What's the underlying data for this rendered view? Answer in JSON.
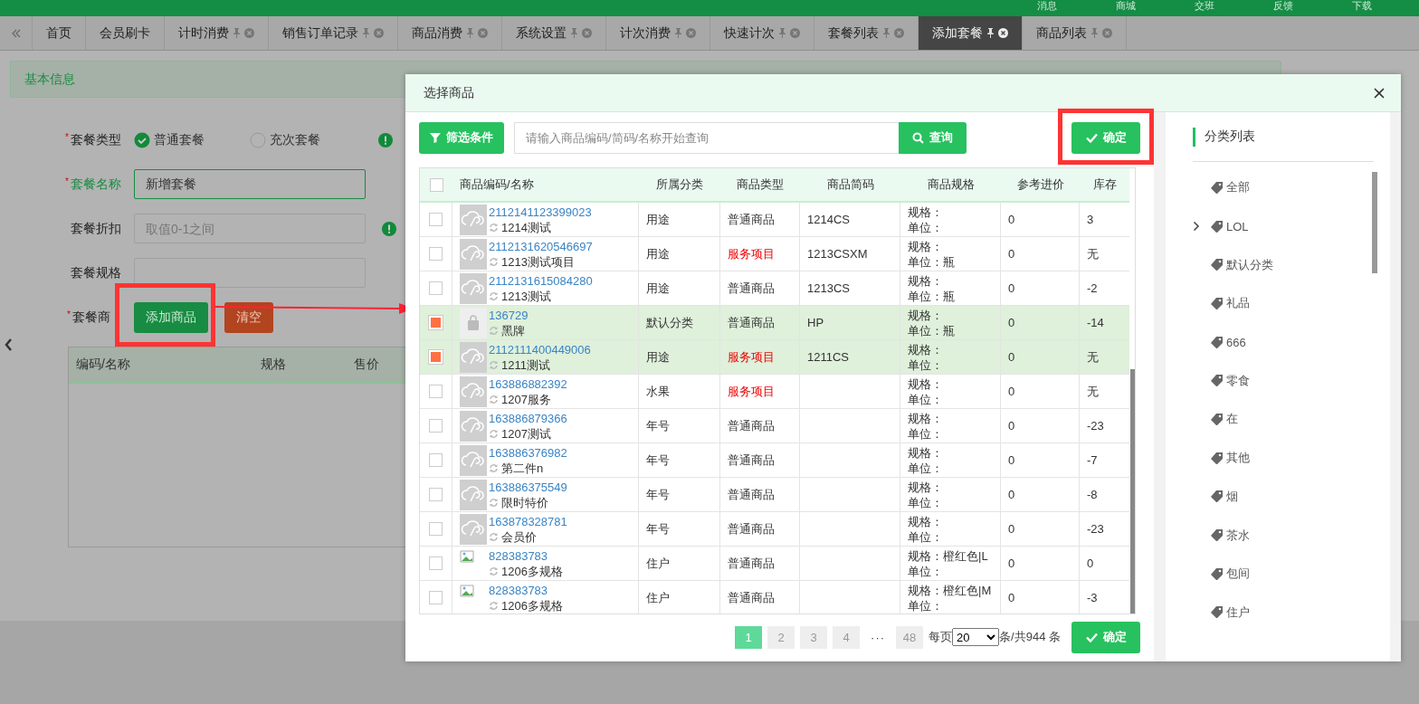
{
  "top_bar": {
    "links": [
      "消息",
      "商城",
      "交班",
      "反馈",
      "下载"
    ]
  },
  "tabs": [
    {
      "label": "首页",
      "selected": false,
      "pinnable": false
    },
    {
      "label": "会员刷卡",
      "selected": false,
      "pinnable": false
    },
    {
      "label": "计时消费",
      "selected": false,
      "pinnable": true
    },
    {
      "label": "销售订单记录",
      "selected": false,
      "pinnable": true
    },
    {
      "label": "商品消费",
      "selected": false,
      "pinnable": true
    },
    {
      "label": "系统设置",
      "selected": false,
      "pinnable": true
    },
    {
      "label": "计次消费",
      "selected": false,
      "pinnable": true
    },
    {
      "label": "快速计次",
      "selected": false,
      "pinnable": true
    },
    {
      "label": "套餐列表",
      "selected": false,
      "pinnable": true
    },
    {
      "label": "添加套餐",
      "selected": true,
      "pinnable": true
    },
    {
      "label": "商品列表",
      "selected": false,
      "pinnable": true
    }
  ],
  "section_title": "基本信息",
  "form": {
    "required_mark": "*",
    "type_row": {
      "label": "套餐类型",
      "required": true,
      "options": [
        {
          "label": "普通套餐",
          "selected": true
        },
        {
          "label": "充次套餐",
          "selected": false
        }
      ]
    },
    "name_row": {
      "label": "套餐名称",
      "required": true,
      "value": "新增套餐",
      "focused": true
    },
    "discount_row": {
      "label": "套餐折扣",
      "required": false,
      "placeholder": "取值0-1之间"
    },
    "spec_row": {
      "label": "套餐规格",
      "required": false
    },
    "goods_row": {
      "label": "套餐商",
      "required": true,
      "add_button": "添加商品",
      "clear_button": "清空"
    },
    "goods_table": {
      "columns": [
        "编码/名称",
        "规格",
        "售价"
      ]
    }
  },
  "dialog": {
    "title": "选择商品",
    "filter_button": "筛选条件",
    "search": {
      "placeholder": "请输入商品编码/简码/名称开始查询"
    },
    "query_button": "查询",
    "confirm_button": "确定",
    "table": {
      "select_all": false,
      "columns": [
        "商品编码/名称",
        "所属分类",
        "商品类型",
        "商品简码",
        "商品规格",
        "参考进价",
        "库存"
      ],
      "rows": [
        {
          "selected": false,
          "kind": "cloud",
          "code": "2112141123399023",
          "name": "1214测试",
          "category": "用途",
          "type": "普通商品",
          "highlighted": false,
          "short_code": "1214CS",
          "spec": "规格：",
          "unit": "单位：",
          "price": "0",
          "stock": "3"
        },
        {
          "selected": false,
          "kind": "cloud",
          "code": "2112131620546697",
          "name": "1213测试项目",
          "category": "用途",
          "type": "服务项目",
          "highlighted": true,
          "short_code": "1213CSXM",
          "spec": "规格：",
          "unit": "单位：瓶",
          "price": "0",
          "stock": "无"
        },
        {
          "selected": false,
          "kind": "cloud",
          "code": "2112131615084280",
          "name": "1213测试",
          "category": "用途",
          "type": "普通商品",
          "highlighted": false,
          "short_code": "1213CS",
          "spec": "规格：",
          "unit": "单位：瓶",
          "price": "0",
          "stock": "-2"
        },
        {
          "selected": true,
          "kind": "bag",
          "code": "136729",
          "name": "黑牌",
          "category": "默认分类",
          "type": "普通商品",
          "highlighted": false,
          "short_code": "HP",
          "spec": "规格：",
          "unit": "单位：瓶",
          "price": "0",
          "stock": "-14"
        },
        {
          "selected": true,
          "kind": "cloud",
          "code": "2112111400449006",
          "name": "1211测试",
          "category": "用途",
          "type": "服务项目",
          "highlighted": true,
          "short_code": "1211CS",
          "spec": "规格：",
          "unit": "单位：",
          "price": "0",
          "stock": "无"
        },
        {
          "selected": false,
          "kind": "cloud",
          "code": "163886882392",
          "name": "1207服务",
          "category": "水果",
          "type": "服务项目",
          "highlighted": true,
          "short_code": "",
          "spec": "规格：",
          "unit": "单位：",
          "price": "0",
          "stock": "无"
        },
        {
          "selected": false,
          "kind": "cloud",
          "code": "163886879366",
          "name": "1207测试",
          "category": "年号",
          "type": "普通商品",
          "highlighted": false,
          "short_code": "",
          "spec": "规格：",
          "unit": "单位：",
          "price": "0",
          "stock": "-23"
        },
        {
          "selected": false,
          "kind": "cloud",
          "code": "163886376982",
          "name": "第二件n",
          "category": "年号",
          "type": "普通商品",
          "highlighted": false,
          "short_code": "",
          "spec": "规格：",
          "unit": "单位：",
          "price": "0",
          "stock": "-7"
        },
        {
          "selected": false,
          "kind": "cloud",
          "code": "163886375549",
          "name": "限时特价",
          "category": "年号",
          "type": "普通商品",
          "highlighted": false,
          "short_code": "",
          "spec": "规格：",
          "unit": "单位：",
          "price": "0",
          "stock": "-8"
        },
        {
          "selected": false,
          "kind": "cloud",
          "code": "163878328781",
          "name": "会员价",
          "category": "年号",
          "type": "普通商品",
          "highlighted": false,
          "short_code": "",
          "spec": "规格：",
          "unit": "单位：",
          "price": "0",
          "stock": "-23"
        },
        {
          "selected": false,
          "kind": "broken",
          "code": "828383783",
          "name": "1206多规格",
          "category": "住户",
          "type": "普通商品",
          "highlighted": false,
          "short_code": "",
          "spec": "规格：橙红色|L",
          "unit": "单位：",
          "price": "0",
          "stock": "0"
        },
        {
          "selected": false,
          "kind": "broken",
          "code": "828383783",
          "name": "1206多规格",
          "category": "住户",
          "type": "普通商品",
          "highlighted": false,
          "short_code": "",
          "spec": "规格：橙红色|M",
          "unit": "单位：",
          "price": "0",
          "stock": "-3"
        }
      ]
    }
  },
  "pagination": {
    "pages": [
      {
        "label": "1",
        "selected": true
      },
      {
        "label": "2",
        "selected": false
      },
      {
        "label": "3",
        "selected": false
      },
      {
        "label": "4",
        "selected": false
      }
    ],
    "ellipsis": "···",
    "last": {
      "label": "48",
      "selected": false
    },
    "per_page_label": "每页",
    "per_page": "20",
    "total": "条/共944 条"
  },
  "footer_confirm": "确定",
  "categories": {
    "title": "分类列表",
    "items": [
      {
        "label": "全部",
        "kind": "leaf"
      },
      {
        "label": "LOL",
        "kind": "group",
        "expanded": false
      },
      {
        "label": "默认分类",
        "kind": "leaf"
      },
      {
        "label": "礼品",
        "kind": "leaf"
      },
      {
        "label": "666",
        "kind": "leaf"
      },
      {
        "label": "零食",
        "kind": "leaf"
      },
      {
        "label": "在",
        "kind": "leaf"
      },
      {
        "label": "其他",
        "kind": "leaf"
      },
      {
        "label": "烟",
        "kind": "leaf"
      },
      {
        "label": "茶水",
        "kind": "leaf"
      },
      {
        "label": "包间",
        "kind": "leaf"
      },
      {
        "label": "住户",
        "kind": "leaf"
      }
    ]
  }
}
